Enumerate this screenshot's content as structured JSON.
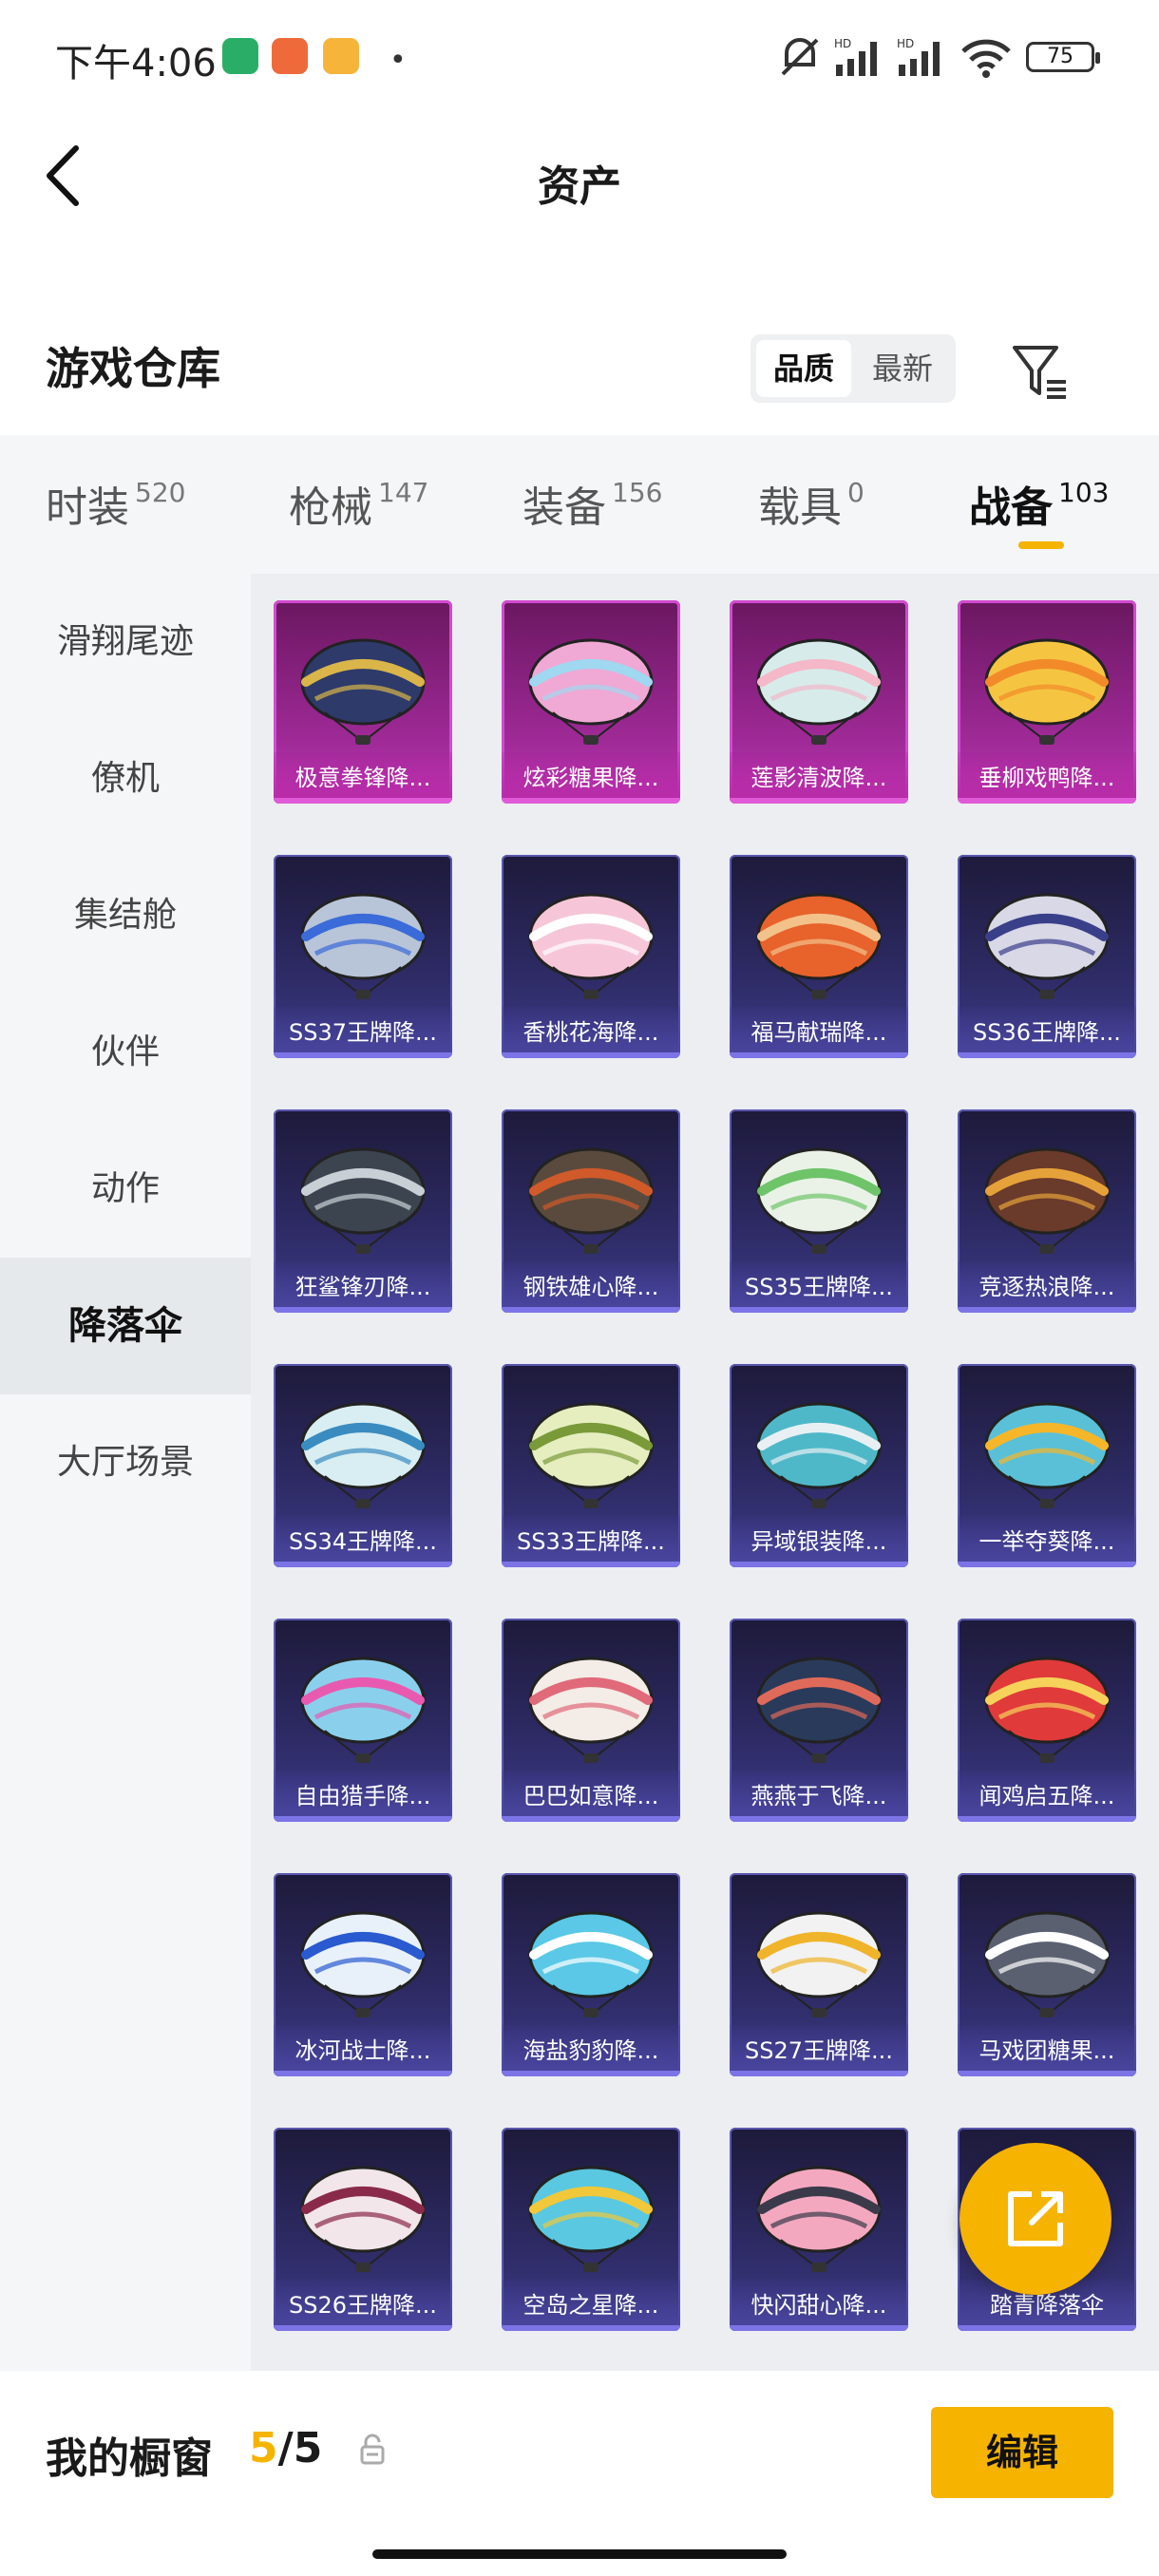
{
  "status_bar": {
    "time": "下午4:06",
    "battery": "75",
    "badges": [
      {
        "icon": "wechat-icon",
        "color": "#2aae67"
      },
      {
        "icon": "shopping-app-icon",
        "color": "#ef6a3a"
      },
      {
        "icon": "note-app-icon",
        "color": "#f6b43a"
      }
    ]
  },
  "nav": {
    "title": "资产",
    "back_icon": "chevron-left-icon"
  },
  "section": {
    "title": "游戏仓库",
    "sort_options": [
      "品质",
      "最新"
    ],
    "filter_icon": "filter-icon"
  },
  "tabs": [
    {
      "label": "时装",
      "count": "520"
    },
    {
      "label": "枪械",
      "count": "147"
    },
    {
      "label": "装备",
      "count": "156"
    },
    {
      "label": "载具",
      "count": "0"
    },
    {
      "label": "战备",
      "count": "103"
    }
  ],
  "active_tab": "战备",
  "sidebar": {
    "items": [
      "滑翔尾迹",
      "僚机",
      "集结舱",
      "伙伴",
      "动作",
      "降落伞",
      "大厅场景"
    ],
    "active": "降落伞"
  },
  "items": [
    {
      "name": "极意拳锋降...",
      "rarity": "legendary",
      "color": "#2d3a6a",
      "accent": "#d9b54a"
    },
    {
      "name": "炫彩糖果降...",
      "rarity": "legendary",
      "color": "#f0a8d4",
      "accent": "#9fd8f0"
    },
    {
      "name": "莲影清波降...",
      "rarity": "legendary",
      "color": "#d7ecea",
      "accent": "#f4b8c9"
    },
    {
      "name": "垂柳戏鸭降...",
      "rarity": "legendary",
      "color": "#f5c542",
      "accent": "#f28a2a"
    },
    {
      "name": "SS37王牌降...",
      "rarity": "epic",
      "color": "#b8c4d8",
      "accent": "#3a6bd8"
    },
    {
      "name": "香桃花海降...",
      "rarity": "epic",
      "color": "#f6c6d8",
      "accent": "#ffffff"
    },
    {
      "name": "福马献瑞降...",
      "rarity": "epic",
      "color": "#e8622c",
      "accent": "#f3c28a"
    },
    {
      "name": "SS36王牌降...",
      "rarity": "epic",
      "color": "#d8d8e6",
      "accent": "#3a3f8a"
    },
    {
      "name": "狂鲨锋刃降...",
      "rarity": "epic",
      "color": "#3c4450",
      "accent": "#c8d0d6"
    },
    {
      "name": "钢铁雄心降...",
      "rarity": "epic",
      "color": "#5a4a3e",
      "accent": "#d05a2a"
    },
    {
      "name": "SS35王牌降...",
      "rarity": "epic",
      "color": "#eaf2e8",
      "accent": "#6fc46a"
    },
    {
      "name": "竞逐热浪降...",
      "rarity": "epic",
      "color": "#6a3a2a",
      "accent": "#e6a23a"
    },
    {
      "name": "SS34王牌降...",
      "rarity": "epic",
      "color": "#d9eef2",
      "accent": "#3a8cc0"
    },
    {
      "name": "SS33王牌降...",
      "rarity": "epic",
      "color": "#e6eec0",
      "accent": "#7a9a3a"
    },
    {
      "name": "异域银装降...",
      "rarity": "epic",
      "color": "#4fb8c8",
      "accent": "#e8f0f4"
    },
    {
      "name": "一举夺葵降...",
      "rarity": "epic",
      "color": "#5ac0d8",
      "accent": "#f5b62a"
    },
    {
      "name": "自由猎手降...",
      "rarity": "epic",
      "color": "#8ad0ec",
      "accent": "#e85ab0"
    },
    {
      "name": "巴巴如意降...",
      "rarity": "epic",
      "color": "#f4ece6",
      "accent": "#e06a7a"
    },
    {
      "name": "燕燕于飞降...",
      "rarity": "epic",
      "color": "#2a3a5a",
      "accent": "#e06a5a"
    },
    {
      "name": "闻鸡启五降...",
      "rarity": "epic",
      "color": "#e03a3a",
      "accent": "#f6d25a"
    },
    {
      "name": "冰河战士降...",
      "rarity": "epic",
      "color": "#e8f0fa",
      "accent": "#2a5ad0"
    },
    {
      "name": "海盐豹豹降...",
      "rarity": "epic",
      "color": "#5ac8e6",
      "accent": "#ffffff"
    },
    {
      "name": "SS27王牌降...",
      "rarity": "epic",
      "color": "#f2f2f2",
      "accent": "#f0b42a"
    },
    {
      "name": "马戏团糖果...",
      "rarity": "epic",
      "color": "#5a6070",
      "accent": "#ffffff"
    },
    {
      "name": "SS26王牌降...",
      "rarity": "epic",
      "color": "#f2e6ea",
      "accent": "#8a2a4a"
    },
    {
      "name": "空岛之星降...",
      "rarity": "epic",
      "color": "#5ac8e0",
      "accent": "#f0c83a"
    },
    {
      "name": "快闪甜心降...",
      "rarity": "epic",
      "color": "#f4a8c0",
      "accent": "#3a3a4a"
    },
    {
      "name": "踏青降落伞",
      "rarity": "epic",
      "color": "#8ad0a0",
      "accent": "#f0e6a0"
    }
  ],
  "share_fab": {
    "icon": "share-export-icon"
  },
  "bottom": {
    "showcase_label": "我的橱窗",
    "showcase_current": "5",
    "showcase_total": "/5",
    "lock_icon": "lock-icon",
    "edit_label": "编辑"
  }
}
